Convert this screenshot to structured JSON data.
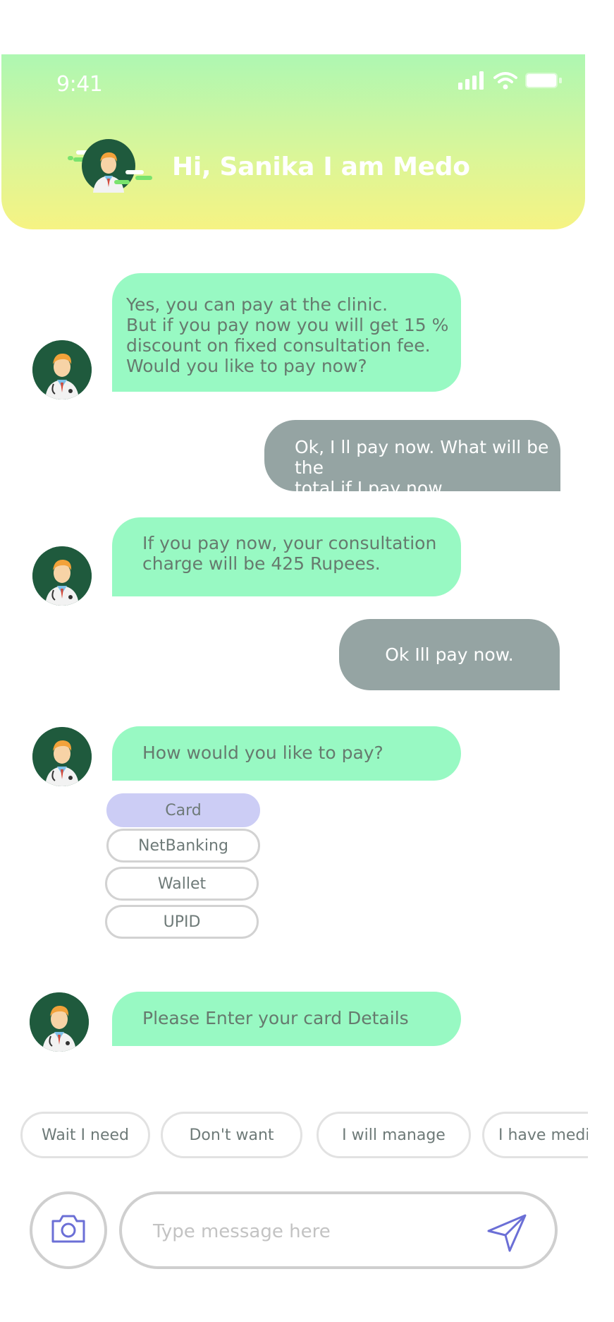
{
  "status_bar": {
    "time": "9:41"
  },
  "header": {
    "title": "Hi, Sanika I am Medo",
    "gradient_top": "#aef7b2",
    "gradient_bottom": "#f6f383"
  },
  "colors": {
    "bot_bubble": "#98f9c3",
    "user_bubble": "#95a4a3",
    "avatar_bg": "#1f5a3d",
    "selected_option": "#cccdf5",
    "accent_icon": "#6b6fd6"
  },
  "messages": [
    {
      "sender": "bot",
      "text": "Yes, you can pay at the clinic.\nBut if you pay now you will get 15 %\ndiscount on fixed consultation fee.\nWould you like to pay now?"
    },
    {
      "sender": "user",
      "text": "Ok, I ll pay now. What will be the\ntotal if I pay now."
    },
    {
      "sender": "bot",
      "text": "If you pay now, your consultation\ncharge will be 425 Rupees."
    },
    {
      "sender": "user",
      "text": "Ok Ill pay now."
    },
    {
      "sender": "bot",
      "text": "How would you like to pay?"
    },
    {
      "sender": "bot",
      "text": "Please Enter your card Details"
    }
  ],
  "payment_options": [
    {
      "label": "Card",
      "selected": true
    },
    {
      "label": "NetBanking",
      "selected": false
    },
    {
      "label": "Wallet",
      "selected": false
    },
    {
      "label": "UPID",
      "selected": false
    }
  ],
  "quick_replies": [
    "Wait I need",
    "Don't want",
    "I will manage",
    "I have medi"
  ],
  "composer": {
    "placeholder": "Type message here",
    "camera_icon": "camera-icon",
    "send_icon": "send-icon"
  }
}
